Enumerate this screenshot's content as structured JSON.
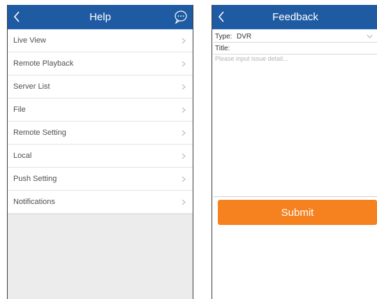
{
  "help_screen": {
    "title": "Help",
    "back_icon": "chevron-left-icon",
    "action_icon": "chat-bubble-icon",
    "items": [
      {
        "label": "Live View"
      },
      {
        "label": "Remote Playback"
      },
      {
        "label": "Server List"
      },
      {
        "label": "File"
      },
      {
        "label": "Remote Setting"
      },
      {
        "label": "Local"
      },
      {
        "label": "Push Setting"
      },
      {
        "label": "Notifications"
      }
    ]
  },
  "feedback_screen": {
    "title": "Feedback",
    "back_icon": "chevron-left-icon",
    "type_label": "Type:",
    "type_value": "DVR",
    "title_label": "Title:",
    "detail_placeholder": "Please input issue detail...",
    "submit_label": "Submit"
  },
  "colors": {
    "header": "#1f5ba2",
    "submit": "#f5811f",
    "empty_area": "#ececec"
  }
}
